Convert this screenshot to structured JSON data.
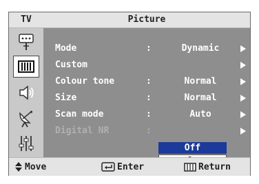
{
  "header": {
    "tv_label": "TV",
    "title": "Picture"
  },
  "sidebar": {
    "icons": [
      "antenna-icon",
      "picture-icon",
      "speaker-icon",
      "satellite-dish-icon",
      "setup-sliders-icon"
    ],
    "selected_index": 1
  },
  "menu": {
    "items": [
      {
        "label": "Mode",
        "separator": ":",
        "value": "Dynamic"
      },
      {
        "label": "Custom",
        "separator": "",
        "value": ""
      },
      {
        "label": "Colour tone",
        "separator": ":",
        "value": "Normal"
      },
      {
        "label": "Size",
        "separator": ":",
        "value": "Normal"
      },
      {
        "label": "Scan mode",
        "separator": ":",
        "value": "Auto"
      },
      {
        "label": "Digital NR",
        "separator": ":",
        "value": ""
      }
    ]
  },
  "dropdown": {
    "selected": "Off",
    "options": [
      "Off",
      "On"
    ]
  },
  "footer": {
    "move": "Move",
    "enter": "Enter",
    "return": "Return"
  },
  "colors": {
    "osd_gray": "#8e8e8e",
    "header_bg": "#e4e4e4",
    "highlight": "#1c3a99"
  }
}
